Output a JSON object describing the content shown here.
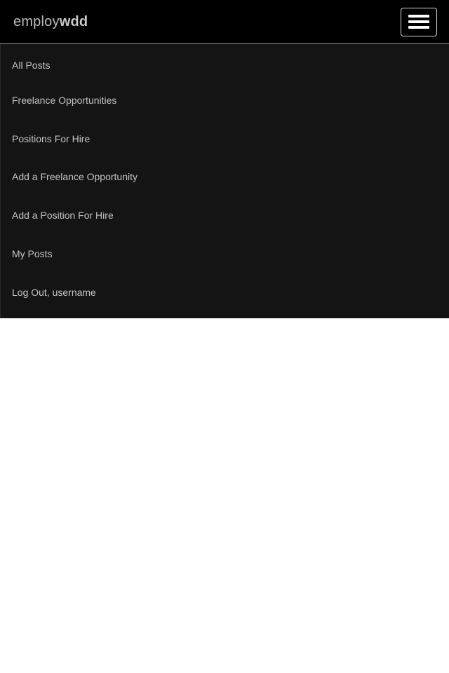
{
  "header": {
    "brand_light": "employ",
    "brand_bold": "wdd",
    "menu_icon": "hamburger-menu-icon"
  },
  "nav": {
    "items": [
      {
        "label": "All Posts"
      },
      {
        "label": "Freelance Opportunities"
      },
      {
        "label": "Positions For Hire"
      },
      {
        "label": "Add a Freelance Opportunity"
      },
      {
        "label": "Add a Position For Hire"
      },
      {
        "label": "My Posts"
      },
      {
        "label": "Log Out, username"
      }
    ]
  },
  "colors": {
    "navbar_bg": "#000000",
    "menu_bg": "#141414",
    "text": "#c4c4c4",
    "page_bg": "#ffffff"
  }
}
